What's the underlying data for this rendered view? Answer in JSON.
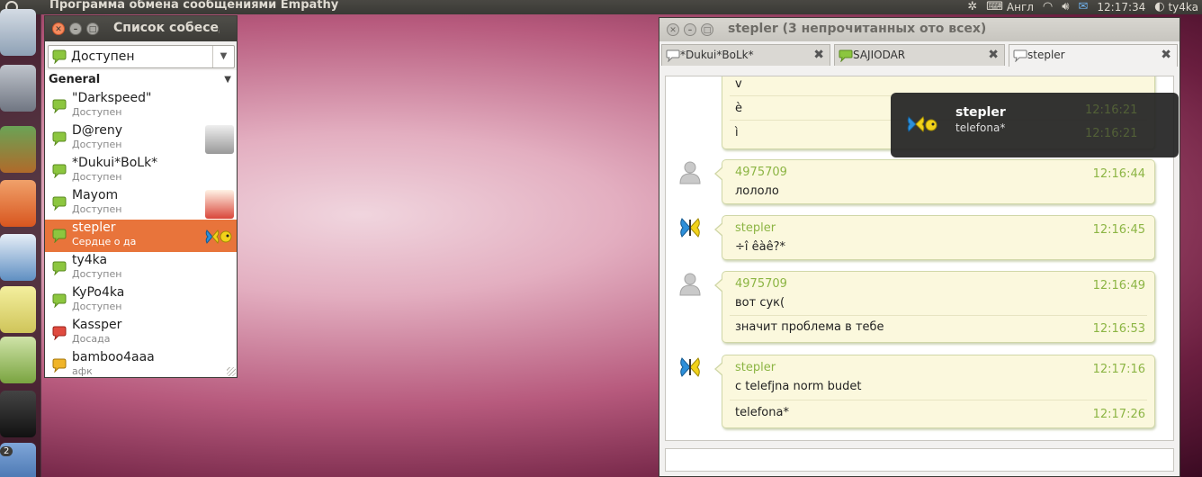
{
  "top_panel": {
    "app_title": "Программа обмена сообщениями Empathy",
    "keyboard_layout": "Англ",
    "clock": "12:17:34",
    "user": "ty4ka"
  },
  "launcher": {
    "workspace_badge": "2"
  },
  "contact_window": {
    "title": "Список собеседников",
    "status_value": "Доступен",
    "group_name": "General",
    "contacts": [
      {
        "name": "\"Darkspeed\"",
        "status": "Доступен",
        "presence": "available"
      },
      {
        "name": "D@reny",
        "status": "Доступен",
        "presence": "available"
      },
      {
        "name": "*Dukui*BoLk*",
        "status": "Доступен",
        "presence": "available"
      },
      {
        "name": "Mayom",
        "status": "Доступен",
        "presence": "available"
      },
      {
        "name": "stepler",
        "status": "Сердце о да",
        "presence": "available"
      },
      {
        "name": "ty4ka",
        "status": "Доступен",
        "presence": "available"
      },
      {
        "name": "KyPo4ka",
        "status": "Доступен",
        "presence": "available"
      },
      {
        "name": "Kassper",
        "status": "Досада",
        "presence": "busy"
      },
      {
        "name": "bamboo4aaa",
        "status": "афк",
        "presence": "away"
      }
    ]
  },
  "chat_window": {
    "title": "stepler (3 непрочитанных ото всех)",
    "tabs": [
      {
        "label": "*Dukui*BoLk*"
      },
      {
        "label": "SAJIODAR"
      },
      {
        "label": "stepler"
      }
    ],
    "messages": [
      {
        "lines": [
          "v",
          "è",
          "ì"
        ]
      },
      {
        "sender": "4975709",
        "time": "12:16:44",
        "lines": [
          "лололо"
        ]
      },
      {
        "sender": "stepler",
        "time": "12:16:45",
        "lines": [
          "÷î êàê?*"
        ]
      },
      {
        "sender": "4975709",
        "time": "12:16:49",
        "lines": [
          "вот сук("
        ],
        "extra": {
          "text": "значит проблема в тебе",
          "time": "12:16:53"
        }
      },
      {
        "sender": "stepler",
        "time": "12:17:16",
        "lines": [
          "с telefjna norm budet"
        ],
        "extra": {
          "text": "telefona*",
          "time": "12:17:26"
        }
      }
    ],
    "hidden_times": [
      "12:16:21",
      "12:16:21"
    ]
  },
  "notification": {
    "title": "stepler",
    "body": "telefona*"
  },
  "colors": {
    "selection": "#e8743b",
    "chat_accent": "#8cb544",
    "message_bg": "#fbf8dd"
  }
}
